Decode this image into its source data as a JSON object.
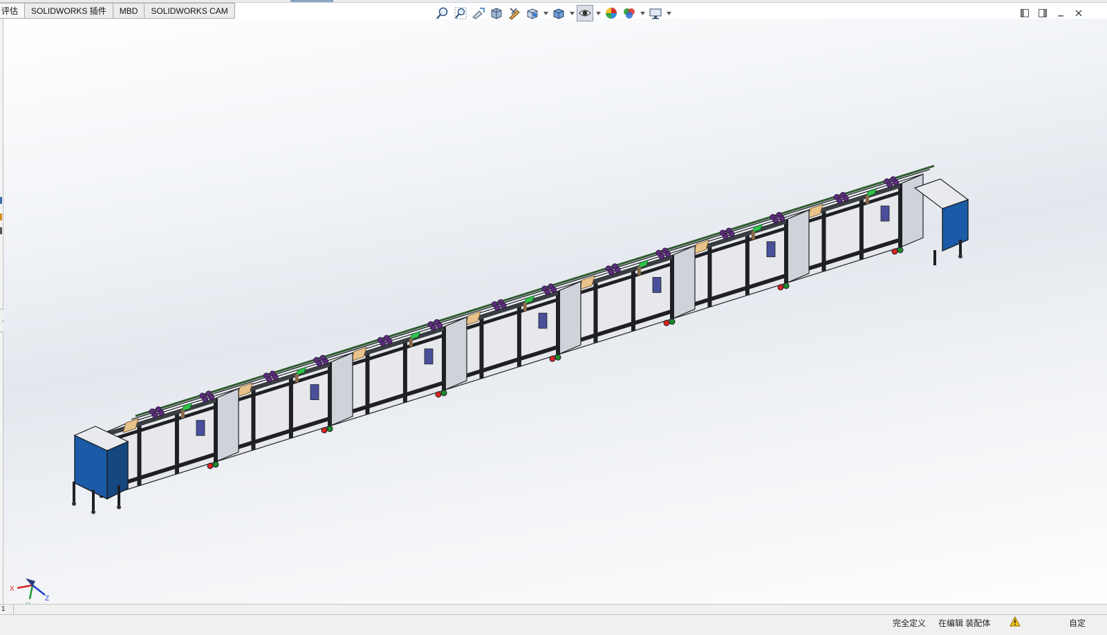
{
  "tabs": [
    {
      "label": "评估"
    },
    {
      "label": "SOLIDWORKS 插件"
    },
    {
      "label": "MBD"
    },
    {
      "label": "SOLIDWORKS CAM"
    }
  ],
  "viewport": {
    "hud_tools": [
      {
        "icon": "zoom-to-fit-icon"
      },
      {
        "icon": "zoom-to-area-icon"
      },
      {
        "icon": "previous-view-icon"
      },
      {
        "icon": "section-view-icon"
      },
      {
        "icon": "dynamic-annotation-icon"
      },
      {
        "icon": "view-orientation-icon",
        "dropdown": true
      },
      {
        "icon": "display-style-icon",
        "dropdown": true
      },
      {
        "icon": "hide-show-items-icon",
        "dropdown": true,
        "active": true
      },
      {
        "icon": "edit-appearance-icon"
      },
      {
        "icon": "apply-scene-icon",
        "dropdown": true
      },
      {
        "icon": "view-settings-icon",
        "dropdown": true
      }
    ],
    "triad": {
      "x_label": "X",
      "y_label": "Y",
      "z_label": "Z"
    },
    "colors": {
      "frame": "#1e2024",
      "cabinet": "#1a5aa6",
      "accent": "#2ec24a",
      "fixture": "#5a2d78",
      "block": "#e8c28a"
    }
  },
  "window_controls": [
    {
      "icon": "restore-left-icon"
    },
    {
      "icon": "restore-right-icon"
    },
    {
      "icon": "minimize-icon"
    },
    {
      "icon": "close-icon"
    }
  ],
  "scrollbar": {
    "page": "1"
  },
  "status": {
    "fully_defined": "完全定义",
    "editing": "在编辑 装配体",
    "custom": "自定"
  }
}
